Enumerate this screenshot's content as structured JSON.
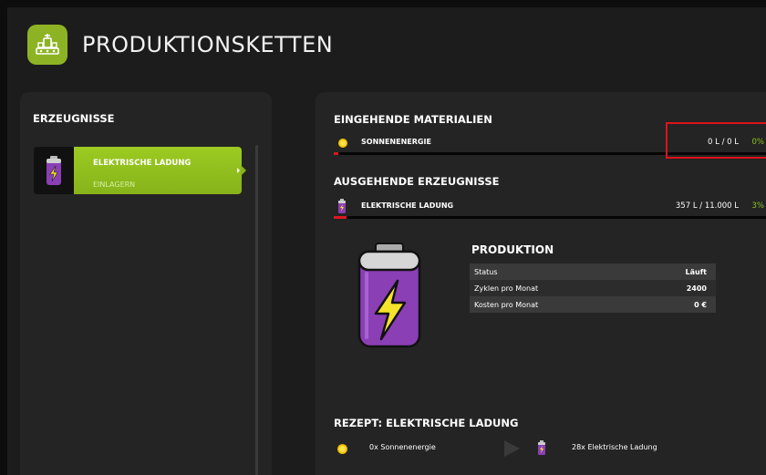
{
  "header": {
    "title": "PRODUKTIONSKETTEN",
    "icon": "factory-icon"
  },
  "left": {
    "title": "ERZEUGNISSE",
    "products": [
      {
        "name": "ELEKTRISCHE LADUNG",
        "action": "EINLAGERN",
        "icon": "battery-icon"
      }
    ]
  },
  "right": {
    "incoming": {
      "title": "EINGEHENDE MATERIALIEN",
      "items": [
        {
          "name": "SONNENENERGIE",
          "amount": "0 L / 0 L",
          "percent": "0%",
          "fill": 0.0,
          "icon": "sun-icon"
        }
      ]
    },
    "outgoing": {
      "title": "AUSGEHENDE ERZEUGNISSE",
      "items": [
        {
          "name": "ELEKTRISCHE LADUNG",
          "amount": "357 L / 11.000 L",
          "percent": "3%",
          "fill": 0.03,
          "icon": "battery-icon"
        }
      ]
    },
    "production": {
      "title": "PRODUKTION",
      "rows": [
        {
          "label": "Status",
          "value": "Läuft"
        },
        {
          "label": "Zyklen pro Monat",
          "value": "2400"
        },
        {
          "label": "Kosten pro Monat",
          "value": "0 €"
        }
      ]
    },
    "recipe": {
      "title": "REZEPT: ELEKTRISCHE LADUNG",
      "input": "0x Sonnenenergie",
      "output": "28x Elektrische Ladung"
    }
  },
  "colors": {
    "accent_green": "#8db324",
    "percent_green": "#8cc21d",
    "progress_red": "#d9181f",
    "highlight_red": "#e0121a",
    "battery_purple": "#8a3fb5"
  }
}
